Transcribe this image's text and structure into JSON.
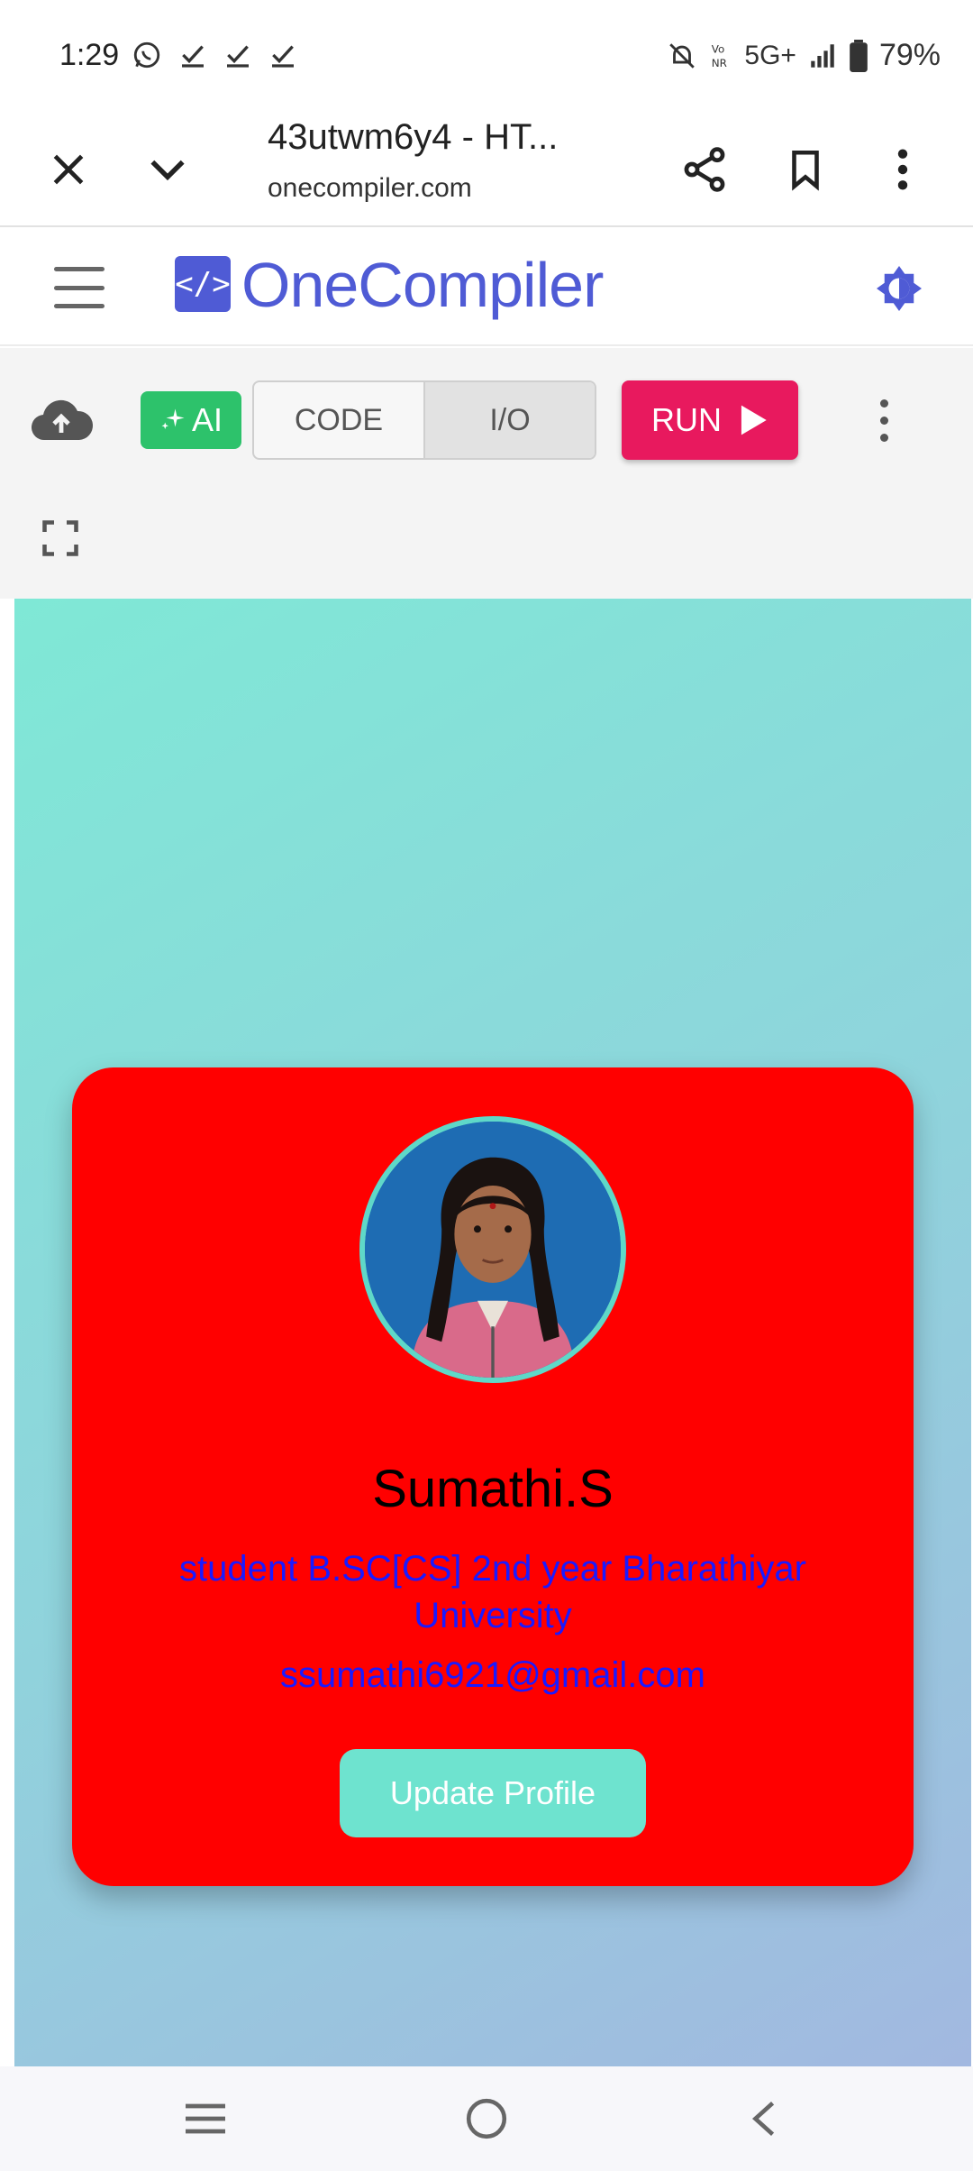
{
  "status_bar": {
    "time": "1:29",
    "battery": "79%",
    "network": "5G+",
    "icons": [
      "whatsapp-icon",
      "check-icon",
      "check-icon",
      "check-icon",
      "mute-icon",
      "volte-icon",
      "signal-icon",
      "battery-icon"
    ]
  },
  "browser": {
    "page_title": "43utwm6y4 - HT...",
    "url": "onecompiler.com",
    "icons": [
      "close-icon",
      "chevron-down-icon",
      "share-icon",
      "bookmark-icon",
      "more-vert-icon"
    ]
  },
  "header": {
    "logo_mark": "</>",
    "logo_text": "OneCompiler",
    "icons": [
      "menu-icon",
      "theme-toggle-icon"
    ]
  },
  "toolbar": {
    "ai_label": "AI",
    "tabs": [
      {
        "label": "CODE",
        "active": false
      },
      {
        "label": "I/O",
        "active": true
      }
    ],
    "run_label": "RUN",
    "icons": [
      "cloud-upload-icon",
      "sparkle-icon",
      "play-icon",
      "more-vert-icon",
      "fullscreen-icon"
    ]
  },
  "profile": {
    "name": "Sumathi.S",
    "role": "student B.SC[CS] 2nd year Bharathiyar University",
    "email": "ssumathi6921@gmail.com",
    "button_label": "Update Profile"
  },
  "colors": {
    "brand": "#4f5bd5",
    "ai_green": "#2dc26b",
    "run_pink": "#e8195e",
    "card_red": "#ff0000",
    "accent_teal": "#6ee3cf",
    "link_blue": "#1a1aff"
  },
  "nav_bar": {
    "icons": [
      "recents-icon",
      "home-icon",
      "back-icon"
    ]
  }
}
